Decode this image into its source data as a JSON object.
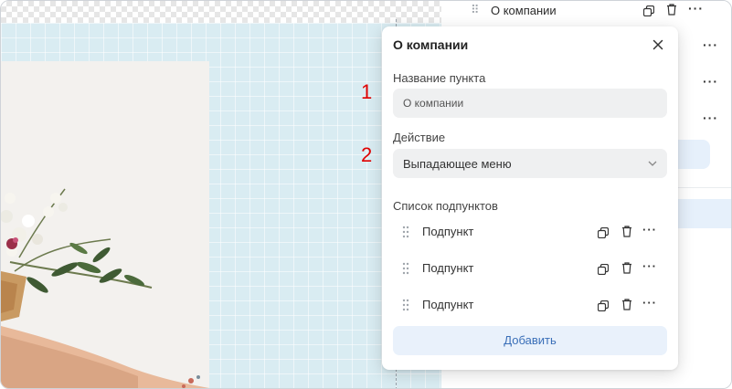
{
  "canvas": {
    "accent": "#d9ecf2"
  },
  "right_panel": {
    "top_item": {
      "label": "О компании",
      "drag_icon": "drag-handle-icon",
      "copy_icon": "copy-icon",
      "delete_icon": "trash-icon",
      "more_icon": "more-icon"
    },
    "more_glyph": "···"
  },
  "popup": {
    "title": "О компании",
    "close_icon": "close-icon",
    "name_field": {
      "label": "Название пункта",
      "value": "О компании"
    },
    "action_field": {
      "label": "Действие",
      "value": "Выпадающее меню"
    },
    "subitems": {
      "label": "Список подпунктов",
      "items": [
        {
          "label": "Подпункт"
        },
        {
          "label": "Подпункт"
        },
        {
          "label": "Подпункт"
        }
      ]
    },
    "add_button": "Добавить",
    "more_glyph": "···"
  },
  "markers": [
    "1",
    "2"
  ],
  "colors": {
    "marker": "#e00000",
    "add_button_bg": "#e9f1fb",
    "add_button_text": "#3a6fb8",
    "field_bg": "#eff0f1"
  }
}
